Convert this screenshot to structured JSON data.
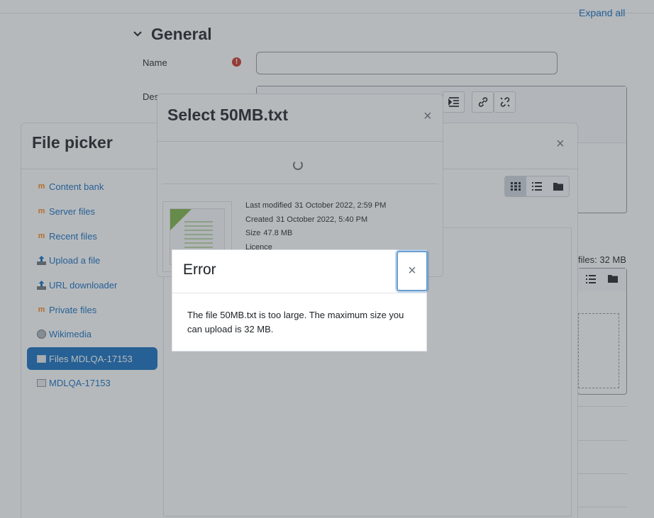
{
  "page": {
    "expand_all": "Expand all",
    "section_title": "General",
    "name_label": "Name",
    "description_label": "Des",
    "max_size_note": "files: 32 MB"
  },
  "file_picker": {
    "title": "File picker",
    "close": "×",
    "repositories": [
      {
        "label": "Content bank",
        "icon": "moodle-icon"
      },
      {
        "label": "Server files",
        "icon": "moodle-icon"
      },
      {
        "label": "Recent files",
        "icon": "moodle-icon"
      },
      {
        "label": "Upload a file",
        "icon": "upload-icon"
      },
      {
        "label": "URL downloader",
        "icon": "upload-icon"
      },
      {
        "label": "Private files",
        "icon": "moodle-icon"
      },
      {
        "label": "Wikimedia",
        "icon": "globe-icon"
      },
      {
        "label": "Files MDLQA-17153",
        "icon": "folder-drive-icon",
        "active": true
      },
      {
        "label": "MDLQA-17153",
        "icon": "folder-drive-icon"
      }
    ]
  },
  "select_dialog": {
    "title": "Select 50MB.txt",
    "close": "×",
    "last_modified_label": "Last modified",
    "last_modified_value": "31 October 2022, 2:59 PM",
    "created_label": "Created",
    "created_value": "31 October 2022, 5:40 PM",
    "size_label": "Size",
    "size_value": "47.8 MB",
    "licence_label": "Licence"
  },
  "error_dialog": {
    "title": "Error",
    "close": "×",
    "message": "The file 50MB.txt is too large. The maximum size you can upload is 32 MB."
  },
  "colors": {
    "link": "#0f6cbf",
    "active_bg": "#0f6cbf",
    "required": "#ca3120",
    "overlay": "rgba(73,80,87,0.4)"
  }
}
